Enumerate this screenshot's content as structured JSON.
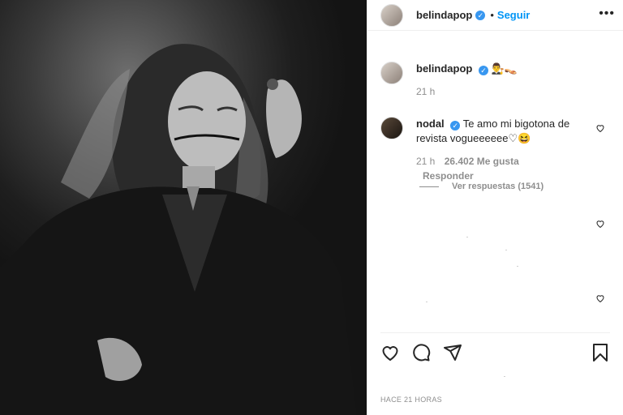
{
  "post": {
    "username": "belindapop",
    "follow_label": "Seguir",
    "separator": "•",
    "more_label": "•••",
    "footer_time": "HACE 21 HORAS"
  },
  "caption": {
    "username": "belindapop",
    "emojis": "👨‍⚖️👡",
    "time": "21 h"
  },
  "comment": {
    "username": "nodal",
    "text": "Te amo mi bigotona de revista vogueeeeee♡😆",
    "time": "21 h",
    "likes": "26.402 Me gusta",
    "reply_label": "Responder",
    "view_replies": "Ver respuestas (1541)"
  },
  "icons": {
    "verified": "verified-badge-icon",
    "like": "heart-icon",
    "comment": "comment-bubble-icon",
    "share": "paper-plane-icon",
    "save": "bookmark-icon"
  },
  "colors": {
    "link": "#0095f6",
    "verified": "#3897f0",
    "muted": "#8e8e8e"
  }
}
